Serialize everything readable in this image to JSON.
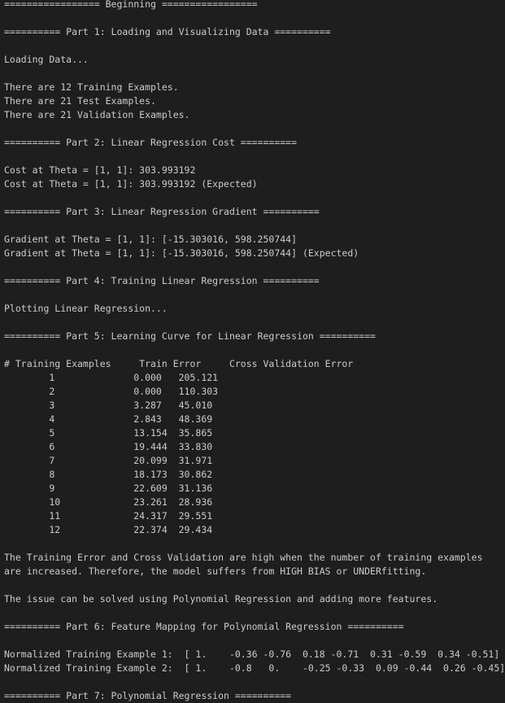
{
  "terminal": {
    "lines": [
      "================= Beginning =================",
      "",
      "========== Part 1: Loading and Visualizing Data ==========",
      "",
      "Loading Data...",
      "",
      "There are 12 Training Examples.",
      "There are 21 Test Examples.",
      "There are 21 Validation Examples.",
      "",
      "========== Part 2: Linear Regression Cost ==========",
      "",
      "Cost at Theta = [1, 1]: 303.993192",
      "Cost at Theta = [1, 1]: 303.993192 (Expected)",
      "",
      "========== Part 3: Linear Regression Gradient ==========",
      "",
      "Gradient at Theta = [1, 1]: [-15.303016, 598.250744]",
      "Gradient at Theta = [1, 1]: [-15.303016, 598.250744] (Expected)",
      "",
      "========== Part 4: Training Linear Regression ==========",
      "",
      "Plotting Linear Regression...",
      "",
      "========== Part 5: Learning Curve for Linear Regression ==========",
      "",
      "# Training Examples     Train Error     Cross Validation Error",
      "        1              0.000   205.121",
      "        2              0.000   110.303",
      "        3              3.287   45.010",
      "        4              2.843   48.369",
      "        5              13.154  35.865",
      "        6              19.444  33.830",
      "        7              20.099  31.971",
      "        8              18.173  30.862",
      "        9              22.609  31.136",
      "        10             23.261  28.936",
      "        11             24.317  29.551",
      "        12             22.374  29.434",
      "",
      "The Training Error and Cross Validation are high when the number of training examples",
      "are increased. Therefore, the model suffers from HIGH BIAS or UNDERfitting.",
      "",
      "The issue can be solved using Polynomial Regression and adding more features.",
      "",
      "========== Part 6: Feature Mapping for Polynomial Regression ==========",
      "",
      "Normalized Training Example 1:  [ 1.    -0.36 -0.76  0.18 -0.71  0.31 -0.59  0.34 -0.51]",
      "Normalized Training Example 2:  [ 1.    -0.8   0.    -0.25 -0.33  0.09 -0.44  0.26 -0.45]",
      "",
      "========== Part 7: Polynomial Regression =========="
    ]
  }
}
